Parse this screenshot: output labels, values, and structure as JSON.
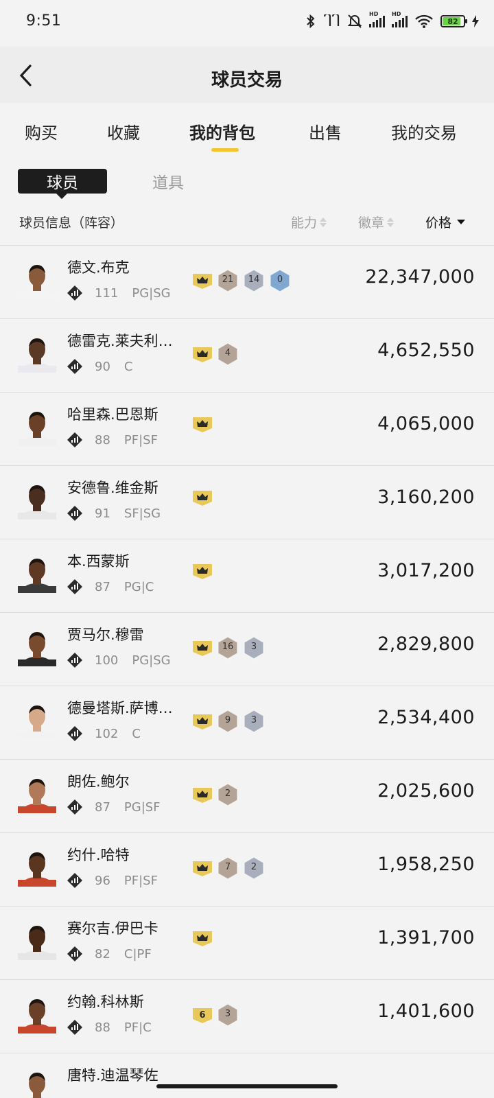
{
  "status_bar": {
    "time": "9:51",
    "battery": "82",
    "signal_label": "HD"
  },
  "header": {
    "title": "球员交易"
  },
  "tabs": [
    {
      "label": "购买"
    },
    {
      "label": "收藏"
    },
    {
      "label": "我的背包"
    },
    {
      "label": "出售"
    },
    {
      "label": "我的交易"
    }
  ],
  "segments": {
    "players": "球员",
    "items": "道具"
  },
  "columns": {
    "info": "球员信息（阵容）",
    "ability": "能力",
    "badge": "徽章",
    "price": "价格"
  },
  "colors": {
    "accent": "#f4c430",
    "crown": "#e9c85a",
    "badge_bronze": "#b4a397",
    "badge_silver": "#a8aebb",
    "badge_blue": "#7fa7cf"
  },
  "players": [
    {
      "name": "德文.布克",
      "rating": "111",
      "positions": "PG|SG",
      "price": "22,347,000",
      "crown": "",
      "badges": [
        {
          "value": "21",
          "tier": "bronze"
        },
        {
          "value": "14",
          "tier": "silver"
        },
        {
          "value": "0",
          "tier": "blue"
        }
      ]
    },
    {
      "name": "德雷克.莱夫利…",
      "rating": "90",
      "positions": "C",
      "price": "4,652,550",
      "crown": "",
      "badges": [
        {
          "value": "4",
          "tier": "bronze"
        }
      ]
    },
    {
      "name": "哈里森.巴恩斯",
      "rating": "88",
      "positions": "PF|SF",
      "price": "4,065,000",
      "crown": "",
      "badges": []
    },
    {
      "name": "安德鲁.维金斯",
      "rating": "91",
      "positions": "SF|SG",
      "price": "3,160,200",
      "crown": "",
      "badges": []
    },
    {
      "name": "本.西蒙斯",
      "rating": "87",
      "positions": "PG|C",
      "price": "3,017,200",
      "crown": "",
      "badges": []
    },
    {
      "name": "贾马尔.穆雷",
      "rating": "100",
      "positions": "PG|SG",
      "price": "2,829,800",
      "crown": "",
      "badges": [
        {
          "value": "16",
          "tier": "bronze"
        },
        {
          "value": "3",
          "tier": "silver"
        }
      ]
    },
    {
      "name": "德曼塔斯.萨博…",
      "rating": "102",
      "positions": "C",
      "price": "2,534,400",
      "crown": "",
      "badges": [
        {
          "value": "9",
          "tier": "bronze"
        },
        {
          "value": "3",
          "tier": "silver"
        }
      ]
    },
    {
      "name": "朗佐.鲍尔",
      "rating": "87",
      "positions": "PG|SF",
      "price": "2,025,600",
      "crown": "",
      "badges": [
        {
          "value": "2",
          "tier": "bronze"
        }
      ]
    },
    {
      "name": "约什.哈特",
      "rating": "96",
      "positions": "PF|SF",
      "price": "1,958,250",
      "crown": "",
      "badges": [
        {
          "value": "7",
          "tier": "bronze"
        },
        {
          "value": "2",
          "tier": "silver"
        }
      ]
    },
    {
      "name": "赛尔吉.伊巴卡",
      "rating": "82",
      "positions": "C|PF",
      "price": "1,391,700",
      "crown": "",
      "badges": []
    },
    {
      "name": "约翰.科林斯",
      "rating": "88",
      "positions": "PF|C",
      "price": "1,401,600",
      "crown": "6",
      "badges": [
        {
          "value": "3",
          "tier": "bronze"
        }
      ]
    },
    {
      "name": "唐特.迪温琴佐",
      "rating": "",
      "positions": "",
      "price": "",
      "crown": "",
      "badges": []
    }
  ]
}
